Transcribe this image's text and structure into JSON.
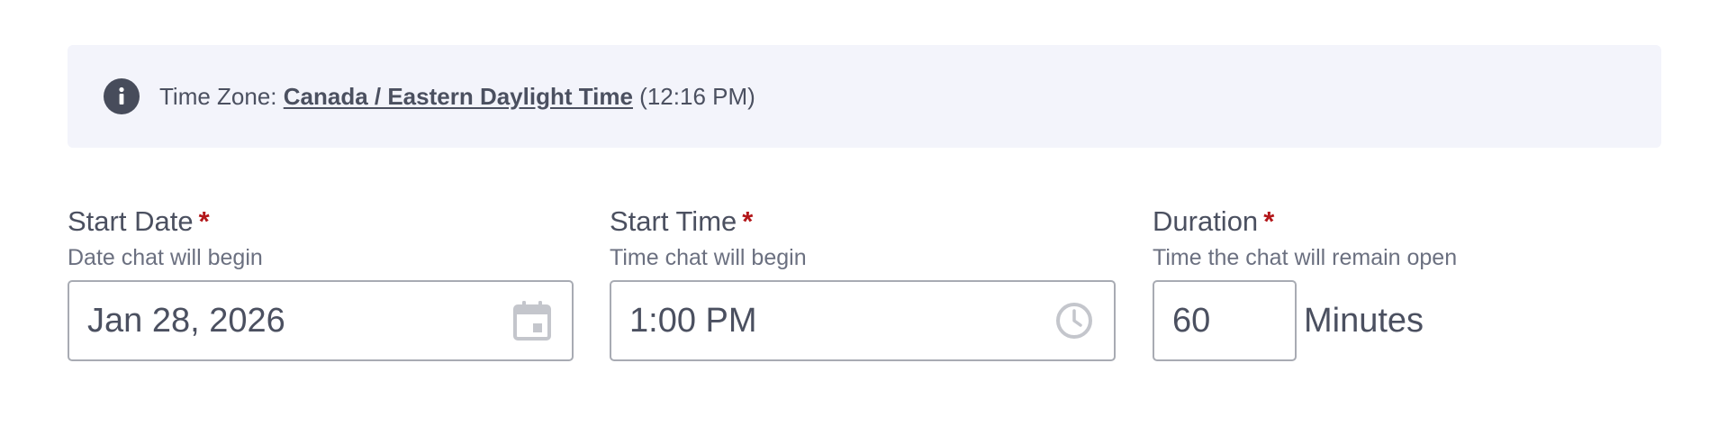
{
  "banner": {
    "icon": "info-icon",
    "prefix": "Time Zone: ",
    "timezone_link": "Canada / Eastern Daylight Time",
    "current_time": " (12:16 PM)"
  },
  "start_date": {
    "label": "Start Date",
    "required_mark": "*",
    "help": "Date chat will begin",
    "value": "Jan 28, 2026",
    "icon": "calendar-icon"
  },
  "start_time": {
    "label": "Start Time",
    "required_mark": "*",
    "help": "Time chat will begin",
    "value": "1:00 PM",
    "icon": "clock-icon"
  },
  "duration": {
    "label": "Duration",
    "required_mark": "*",
    "help": "Time the chat will remain open",
    "value": "60",
    "unit": "Minutes"
  },
  "colors": {
    "banner_bg": "#f3f4fb",
    "text": "#4b5060",
    "required": "#b3171a",
    "input_border": "#a8abb3",
    "icon_grey": "#c4c6cc"
  }
}
